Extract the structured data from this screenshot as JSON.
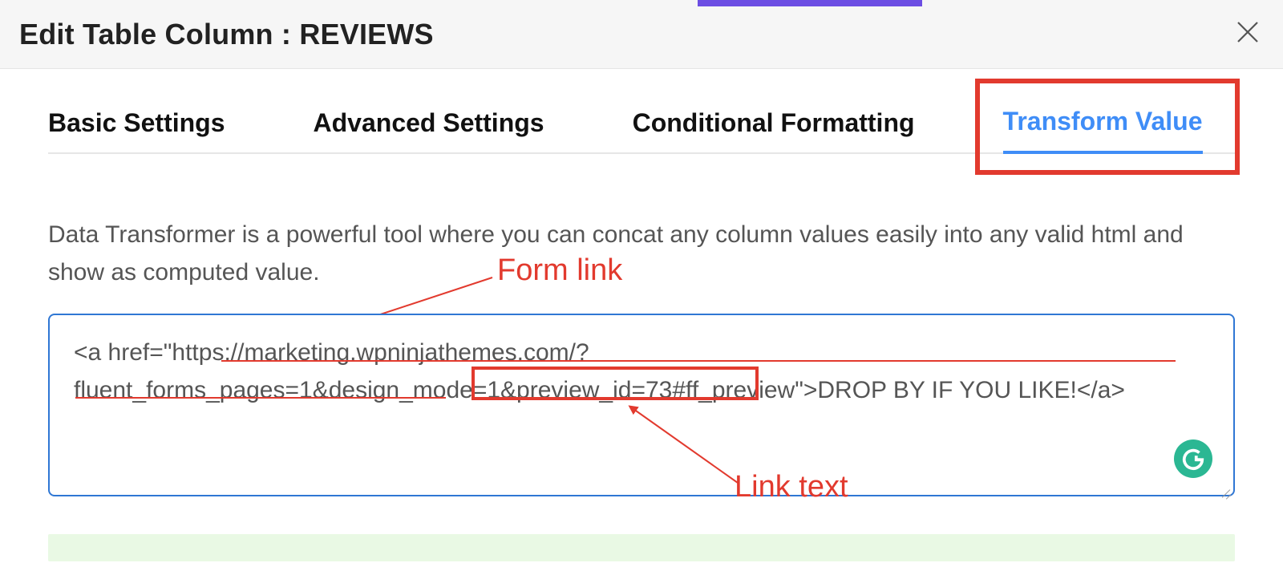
{
  "header": {
    "title": "Edit Table Column : REVIEWS"
  },
  "tabs": {
    "basic": "Basic Settings",
    "advanced": "Advanced Settings",
    "conditional": "Conditional Formatting",
    "transform": "Transform Value"
  },
  "description": "Data Transformer is a powerful tool where you can concat any column values easily into any valid html and show as computed value.",
  "textarea": {
    "value": "<a href=\"https://marketing.wpninjathemes.com/?fluent_forms_pages=1&design_mode=1&preview_id=73#ff_preview\">DROP BY IF YOU LIKE!</a>"
  },
  "annotations": {
    "form_link": "Form link",
    "link_text": "Link text"
  }
}
